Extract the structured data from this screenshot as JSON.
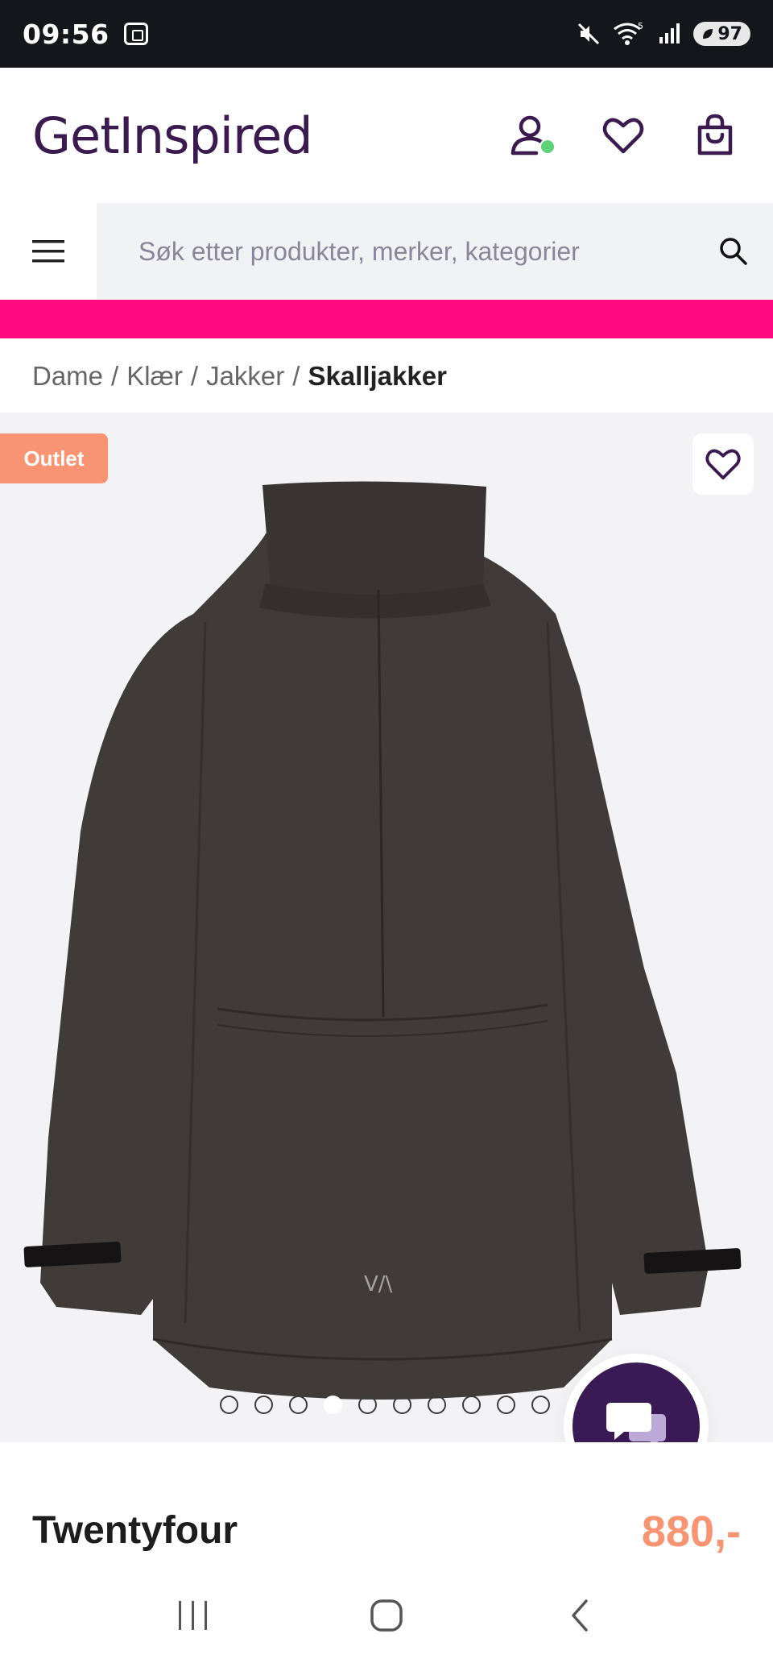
{
  "status_bar": {
    "time": "09:56",
    "battery": "97",
    "network_label": "5"
  },
  "header": {
    "logo": "GetInspired",
    "icons": [
      "account-icon",
      "heart-icon",
      "shopping-bag-icon"
    ]
  },
  "search": {
    "placeholder": "Søk etter produkter, merker, kategorier"
  },
  "promo": {
    "color": "#ff0a7f"
  },
  "breadcrumb": {
    "items": [
      "Dame",
      "Klær",
      "Jakker"
    ],
    "current": "Skalljakker",
    "separator": "/"
  },
  "gallery": {
    "badge": "Outlet",
    "badge_color": "#f99473",
    "image_count": 10,
    "active_index": 3
  },
  "product": {
    "brand": "Twentyfour",
    "price": "880,-",
    "price_color": "#f99473"
  },
  "colors": {
    "brand_purple": "#3a1a4f",
    "chat_purple": "#3a1a55",
    "status_bg": "#14161c"
  },
  "chat": {
    "icon": "chat-bubbles-icon"
  },
  "nav_bar": {
    "buttons": [
      "recent-apps-icon",
      "home-icon",
      "back-icon"
    ]
  }
}
